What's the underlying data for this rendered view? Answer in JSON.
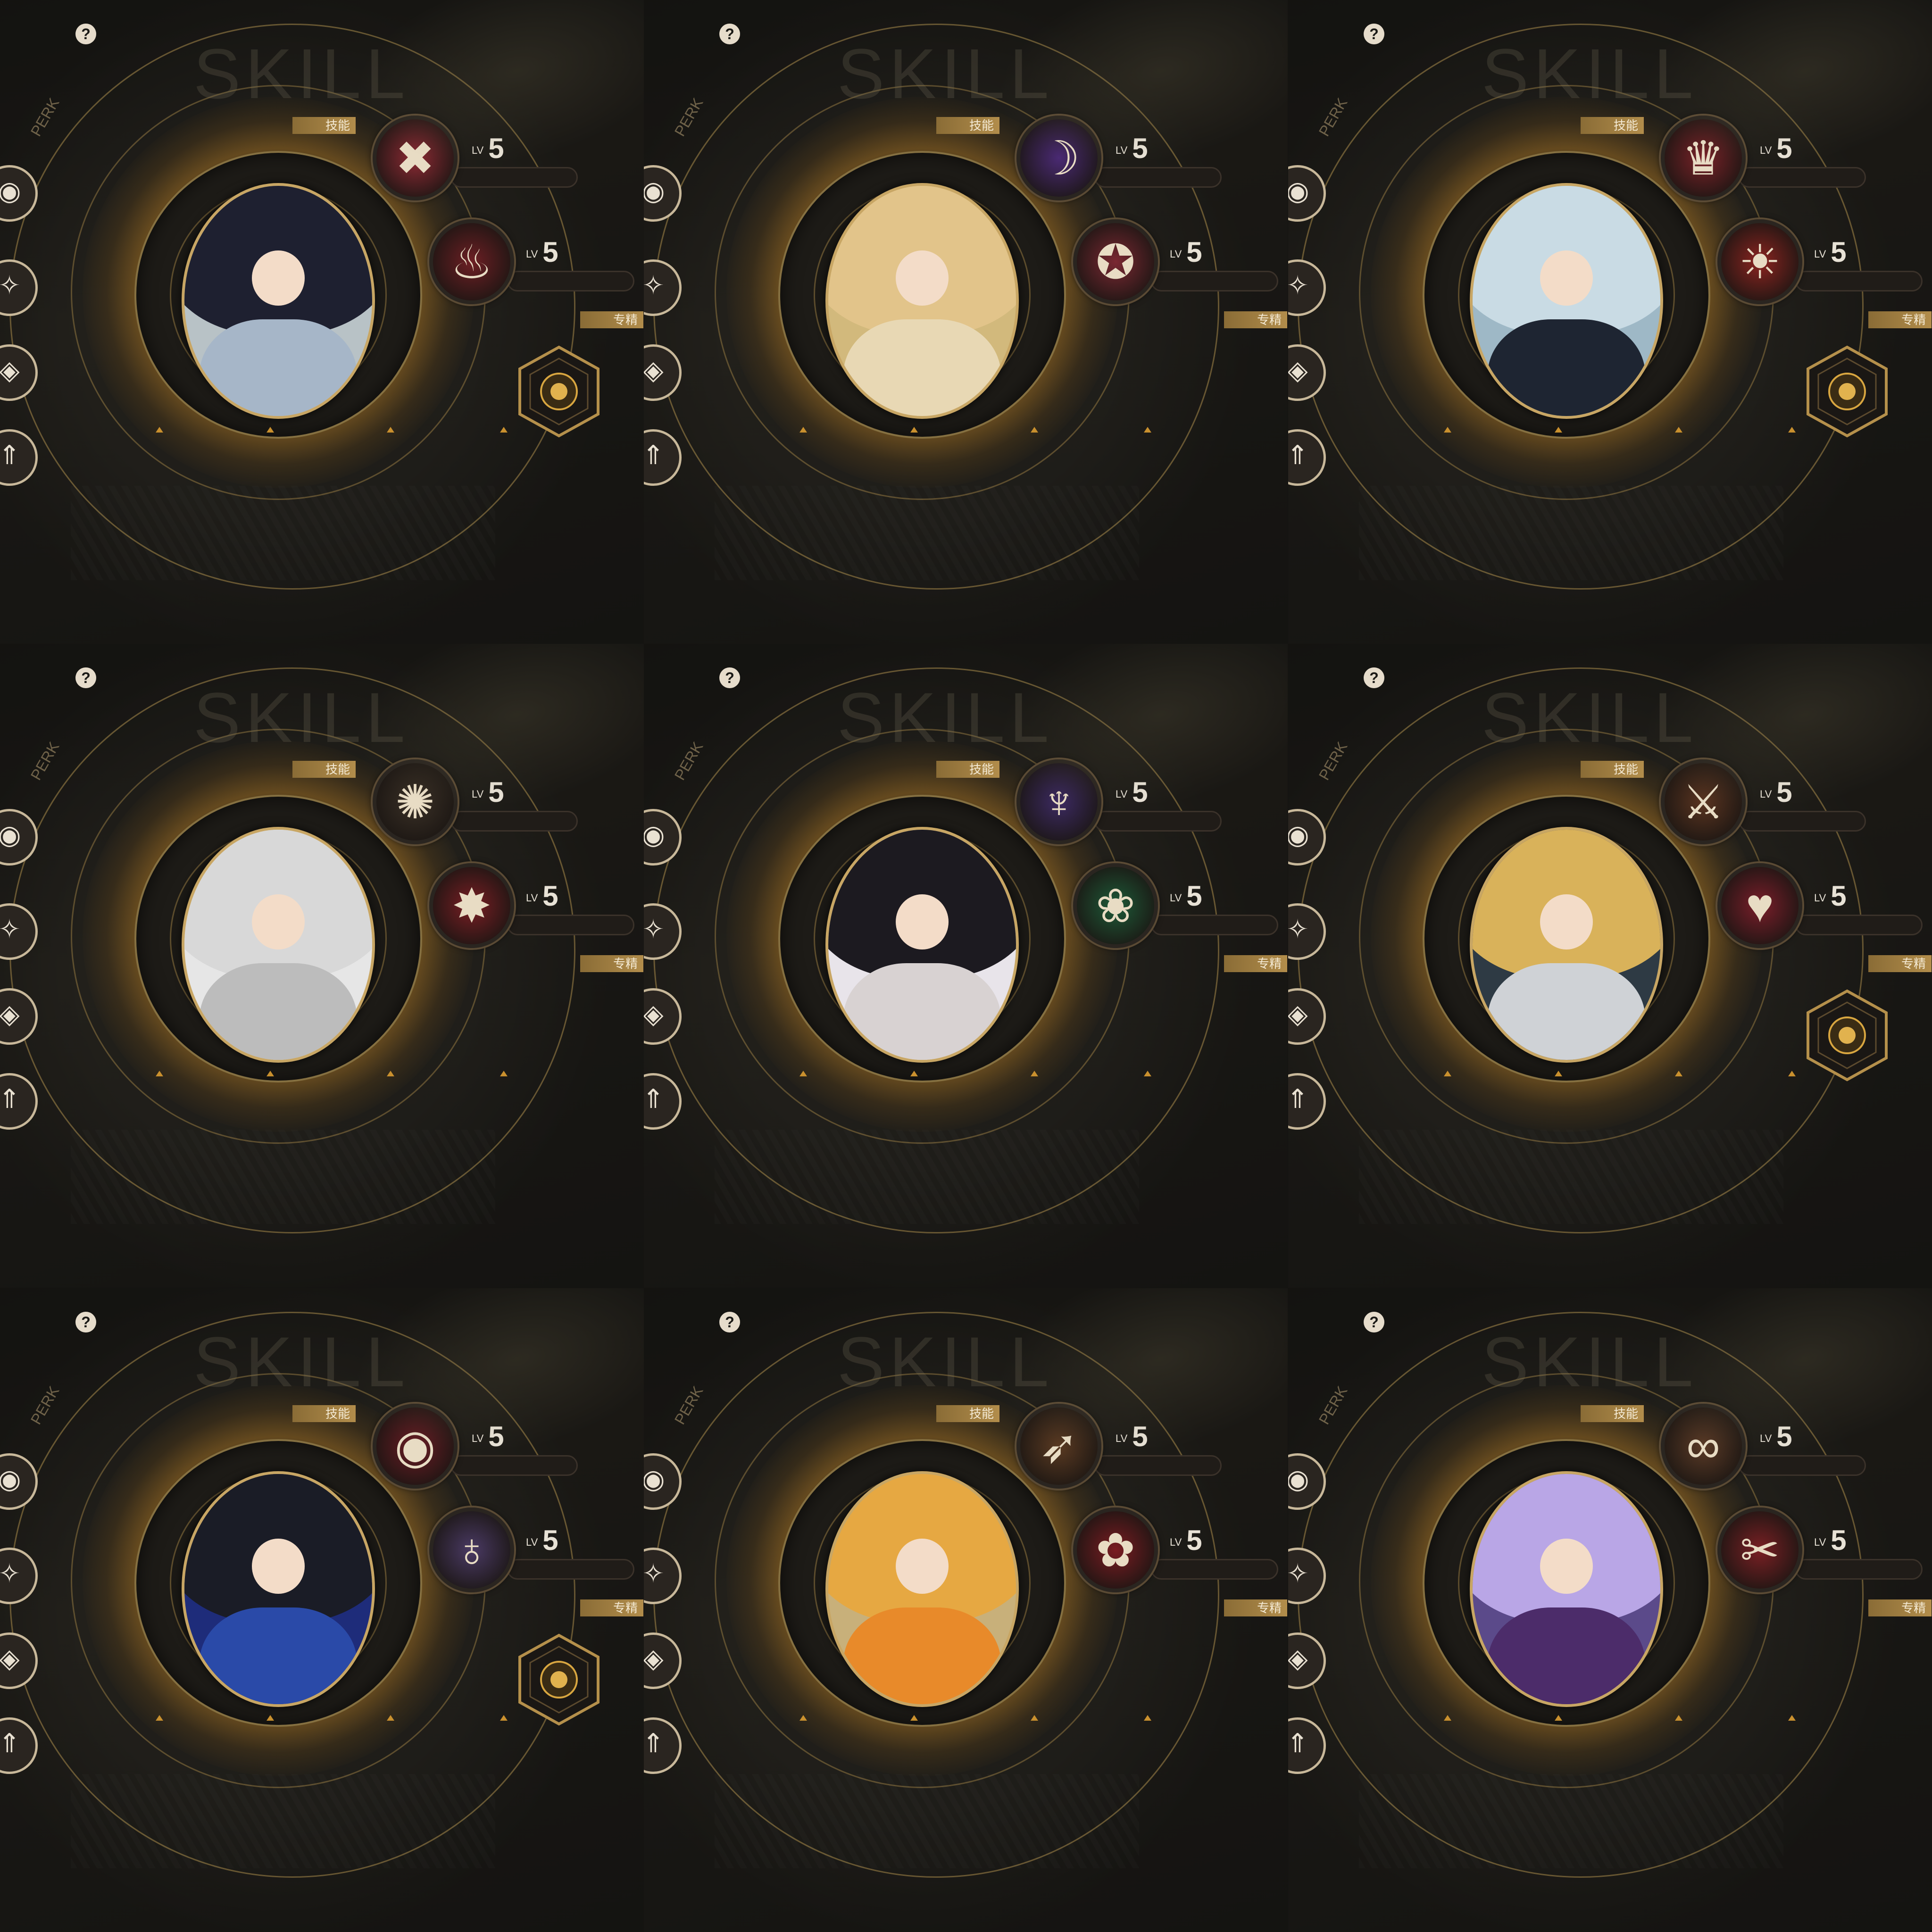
{
  "panels": [
    {
      "skill_title": "SKILL",
      "help": "?",
      "perk_label": "PERK",
      "tag_skill": "技能",
      "tag_spec": "专精",
      "lv_prefix": "LV",
      "skill1_level": "5",
      "skill2_level": "5",
      "skill1_icon": "crossed-blades-icon",
      "skill2_icon": "crimson-lotus-icon",
      "skill1_glyph": "✖",
      "skill2_glyph": "♨",
      "skill1_color": "#8e2a34",
      "skill2_color": "#6d1f24",
      "has_spec_hex": true,
      "hair": "#1e2030",
      "body": "#a6b6c8",
      "bg": "#b8c2c6"
    },
    {
      "skill_title": "SKILL",
      "help": "?",
      "perk_label": "PERK",
      "tag_skill": "技能",
      "tag_spec": "专精",
      "lv_prefix": "LV",
      "skill1_level": "5",
      "skill2_level": "5",
      "skill1_icon": "purple-claw-icon",
      "skill2_icon": "compass-icon",
      "skill1_glyph": "☽",
      "skill2_glyph": "✪",
      "skill1_color": "#4a2a73",
      "skill2_color": "#7a2832",
      "has_spec_hex": false,
      "hair": "#e2c48a",
      "body": "#e8d8b4",
      "bg": "#d2b97c"
    },
    {
      "skill_title": "SKILL",
      "help": "?",
      "perk_label": "PERK",
      "tag_skill": "技能",
      "tag_spec": "专精",
      "lv_prefix": "LV",
      "skill1_level": "5",
      "skill2_level": "5",
      "skill1_icon": "flame-crown-icon",
      "skill2_icon": "sun-flame-icon",
      "skill1_glyph": "♛",
      "skill2_glyph": "☀",
      "skill1_color": "#7a2228",
      "skill2_color": "#8c2420",
      "has_spec_hex": true,
      "hair": "#c9dbe4",
      "body": "#1e2532",
      "bg": "#9eb8c6"
    },
    {
      "skill_title": "SKILL",
      "help": "?",
      "perk_label": "PERK",
      "tag_skill": "技能",
      "tag_spec": "专精",
      "lv_prefix": "LV",
      "skill1_level": "5",
      "skill2_level": "5",
      "skill1_icon": "swirl-icon",
      "skill2_icon": "explosion-icon",
      "skill1_glyph": "✺",
      "skill2_glyph": "✸",
      "skill1_color": "#3a3026",
      "skill2_color": "#7a1e24",
      "has_spec_hex": false,
      "hair": "#d8d8d8",
      "body": "#bcbcbc",
      "bg": "#e6e6e6"
    },
    {
      "skill_title": "SKILL",
      "help": "?",
      "perk_label": "PERK",
      "tag_skill": "技能",
      "tag_spec": "专精",
      "lv_prefix": "LV",
      "skill1_level": "5",
      "skill2_level": "5",
      "skill1_icon": "purple-sigil-icon",
      "skill2_icon": "lotus-icon",
      "skill1_glyph": "♆",
      "skill2_glyph": "❀",
      "skill1_color": "#3c2a62",
      "skill2_color": "#1e5a38",
      "has_spec_hex": false,
      "hair": "#1c1a20",
      "body": "#d8d2d2",
      "bg": "#e8e4ea"
    },
    {
      "skill_title": "SKILL",
      "help": "?",
      "perk_label": "PERK",
      "tag_skill": "技能",
      "tag_spec": "专精",
      "lv_prefix": "LV",
      "skill1_level": "5",
      "skill2_level": "5",
      "skill1_icon": "spear-icon",
      "skill2_icon": "heart-wing-icon",
      "skill1_glyph": "⚔",
      "skill2_glyph": "♥",
      "skill1_color": "#5a3420",
      "skill2_color": "#7a1e2a",
      "has_spec_hex": true,
      "hair": "#d9b25a",
      "body": "#cfd2d6",
      "bg": "#2e3a44"
    },
    {
      "skill_title": "SKILL",
      "help": "?",
      "perk_label": "PERK",
      "tag_skill": "技能",
      "tag_spec": "专精",
      "lv_prefix": "LV",
      "skill1_level": "5",
      "skill2_level": "5",
      "skill1_icon": "red-orb-icon",
      "skill2_icon": "spinning-top-icon",
      "skill1_glyph": "◉",
      "skill2_glyph": "♁",
      "skill1_color": "#6a1c24",
      "skill2_color": "#4a3a64",
      "has_spec_hex": true,
      "hair": "#1a1c26",
      "body": "#2a4aa8",
      "bg": "#1e2c7a"
    },
    {
      "skill_title": "SKILL",
      "help": "?",
      "perk_label": "PERK",
      "tag_skill": "技能",
      "tag_spec": "专精",
      "lv_prefix": "LV",
      "skill1_level": "5",
      "skill2_level": "5",
      "skill1_icon": "bullet-icon",
      "skill2_icon": "rose-icon",
      "skill1_glyph": "➶",
      "skill2_glyph": "✿",
      "skill1_color": "#5a3a22",
      "skill2_color": "#7a1c22",
      "has_spec_hex": false,
      "hair": "#e6a842",
      "body": "#e88a2a",
      "bg": "#c8b07a"
    },
    {
      "skill_title": "SKILL",
      "help": "?",
      "perk_label": "PERK",
      "tag_skill": "技能",
      "tag_spec": "专精",
      "lv_prefix": "LV",
      "skill1_level": "5",
      "skill2_level": "5",
      "skill1_icon": "chain-rings-icon",
      "skill2_icon": "dagger-coil-icon",
      "skill1_glyph": "∞",
      "skill2_glyph": "✂",
      "skill1_color": "#5a3a26",
      "skill2_color": "#7a2024",
      "has_spec_hex": false,
      "hair": "#b9a6e6",
      "body": "#4c2c6a",
      "bg": "#5b4a8a"
    }
  ]
}
